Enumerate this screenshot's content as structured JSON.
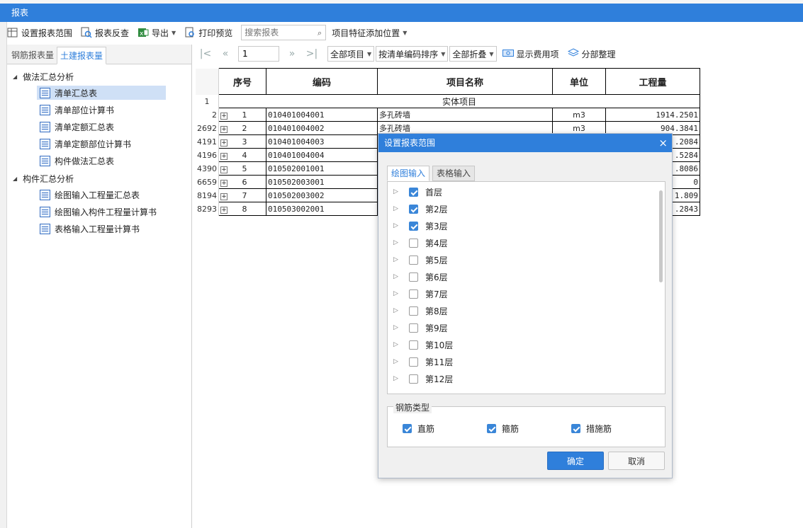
{
  "window": {
    "title": "报表"
  },
  "toolbar": {
    "set_range": "设置报表范围",
    "report_check": "报表反查",
    "export": "导出",
    "print_preview": "打印预览",
    "search_placeholder": "搜索报表",
    "feature_position": "项目特征添加位置"
  },
  "left_tabs": {
    "rebar": "钢筋报表量",
    "civil": "土建报表量"
  },
  "tree": {
    "group1": "做法汇总分析",
    "group1_items": [
      "清单汇总表",
      "清单部位计算书",
      "清单定额汇总表",
      "清单定额部位计算书",
      "构件做法汇总表"
    ],
    "group2": "构件汇总分析",
    "group2_items": [
      "绘图输入工程量汇总表",
      "绘图输入构件工程量计算书",
      "表格输入工程量计算书"
    ]
  },
  "nav": {
    "page": "1",
    "scope": "全部项目",
    "sort": "按清单编码排序",
    "fold": "全部折叠",
    "show_fee": "显示费用项",
    "section_arrange": "分部整理"
  },
  "table": {
    "headers": [
      "序号",
      "编码",
      "项目名称",
      "单位",
      "工程量"
    ],
    "section_label": "实体项目",
    "section_row_no": "1",
    "rows": [
      {
        "row_no": "2",
        "seq": "1",
        "code": "010401004001",
        "name": "多孔砖墙",
        "unit": "m3",
        "qty": "1914.2501"
      },
      {
        "row_no": "2692",
        "seq": "2",
        "code": "010401004002",
        "name": "多孔砖墙",
        "unit": "m3",
        "qty": "904.3841"
      },
      {
        "row_no": "4191",
        "seq": "3",
        "code": "010401004003",
        "name": "",
        "unit": "",
        "qty": ".2084"
      },
      {
        "row_no": "4196",
        "seq": "4",
        "code": "010401004004",
        "name": "",
        "unit": "",
        "qty": ".5284"
      },
      {
        "row_no": "4390",
        "seq": "5",
        "code": "010502001001",
        "name": "",
        "unit": "",
        "qty": ".8086"
      },
      {
        "row_no": "6659",
        "seq": "6",
        "code": "010502003001",
        "name": "",
        "unit": "",
        "qty": "0"
      },
      {
        "row_no": "8194",
        "seq": "7",
        "code": "010502003002",
        "name": "",
        "unit": "",
        "qty": "1.809"
      },
      {
        "row_no": "8293",
        "seq": "8",
        "code": "010503002001",
        "name": "",
        "unit": "",
        "qty": ".2843"
      }
    ]
  },
  "dialog": {
    "title": "设置报表范围",
    "close": "×",
    "tab_draw": "绘图输入",
    "tab_table": "表格输入",
    "floors": [
      {
        "label": "首层",
        "checked": true
      },
      {
        "label": "第2层",
        "checked": true
      },
      {
        "label": "第3层",
        "checked": true
      },
      {
        "label": "第4层",
        "checked": false
      },
      {
        "label": "第5层",
        "checked": false
      },
      {
        "label": "第6层",
        "checked": false
      },
      {
        "label": "第7层",
        "checked": false
      },
      {
        "label": "第8层",
        "checked": false
      },
      {
        "label": "第9层",
        "checked": false
      },
      {
        "label": "第10层",
        "checked": false
      },
      {
        "label": "第11层",
        "checked": false
      },
      {
        "label": "第12层",
        "checked": false
      }
    ],
    "rebar_type_label": "钢筋类型",
    "rebar_types": [
      {
        "label": "直筋",
        "checked": true
      },
      {
        "label": "箍筋",
        "checked": true
      },
      {
        "label": "措施筋",
        "checked": true
      }
    ],
    "ok": "确定",
    "cancel": "取消"
  },
  "colors": {
    "accent": "#2f7fdb",
    "selected_row": "#cfe0f6"
  }
}
